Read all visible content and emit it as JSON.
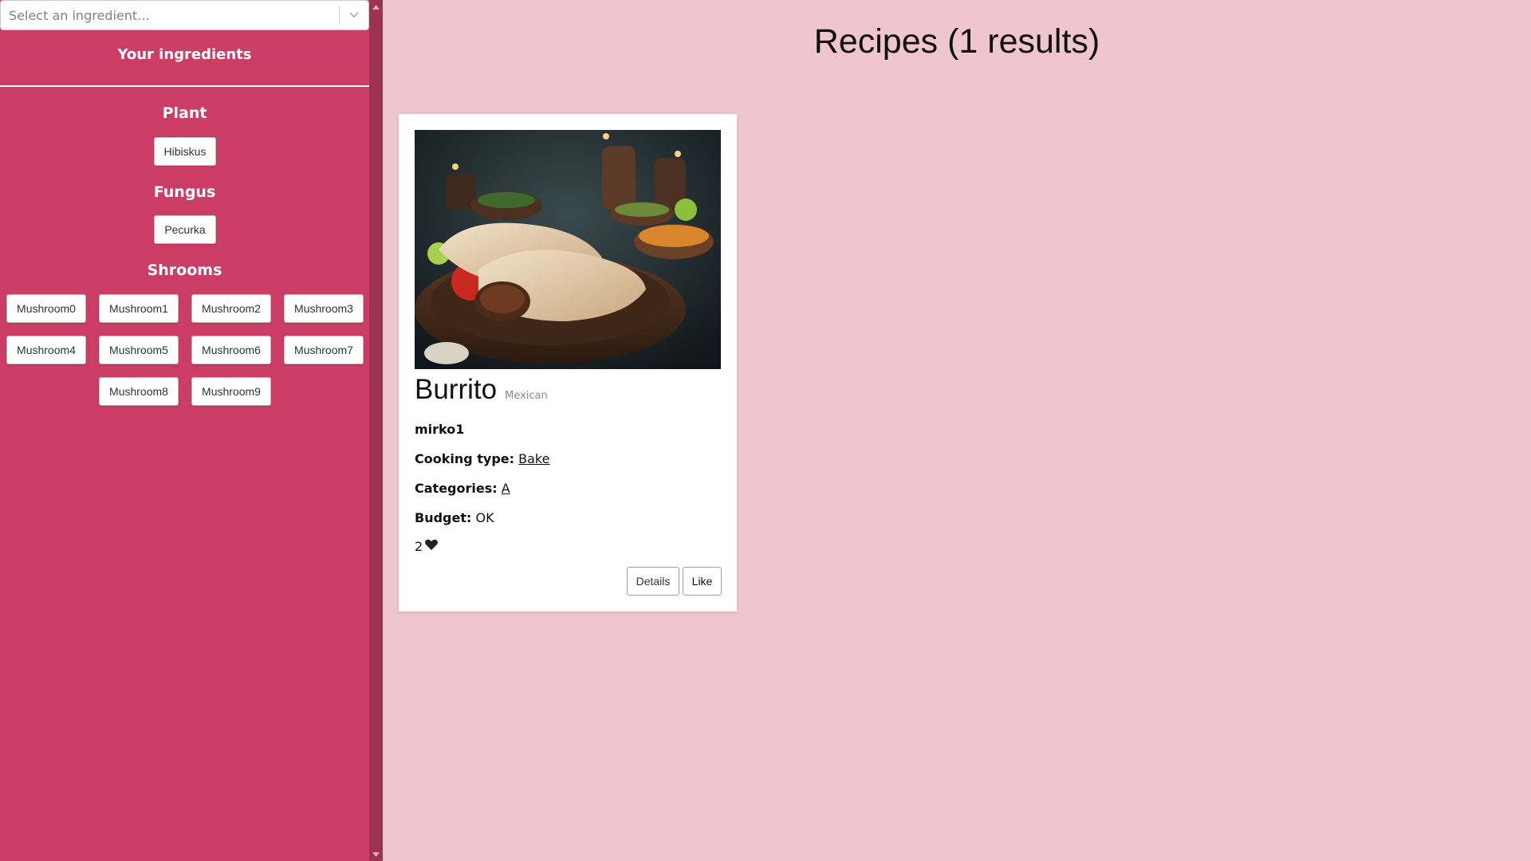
{
  "sidebar": {
    "select_placeholder": "Select an ingredient...",
    "title": "Your ingredients",
    "groups": [
      {
        "name": "Plant",
        "items": [
          "Hibiskus"
        ]
      },
      {
        "name": "Fungus",
        "items": [
          "Pecurka"
        ]
      },
      {
        "name": "Shrooms",
        "items": [
          "Mushroom0",
          "Mushroom1",
          "Mushroom2",
          "Mushroom3",
          "Mushroom4",
          "Mushroom5",
          "Mushroom6",
          "Mushroom7",
          "Mushroom8",
          "Mushroom9"
        ]
      }
    ]
  },
  "main": {
    "title": "Recipes (1 results)",
    "recipe": {
      "name": "Burrito",
      "cuisine": "Mexican",
      "author": "mirko1",
      "cooking_type_label": "Cooking type:",
      "cooking_type": "Bake",
      "categories_label": "Categories:",
      "categories": "A",
      "budget_label": "Budget:",
      "budget": "OK",
      "likes": "2",
      "details_label": "Details",
      "like_label": "Like"
    }
  },
  "colors": {
    "sidebar_bg": "#cc3d65",
    "page_bg": "#efc5d0",
    "scrollbar_bg": "#9c3451"
  },
  "icons": {
    "select_chevron": "chevron-down-icon",
    "like": "heart-icon",
    "scroll_up": "scroll-up-arrow-icon",
    "scroll_down": "scroll-down-arrow-icon"
  }
}
